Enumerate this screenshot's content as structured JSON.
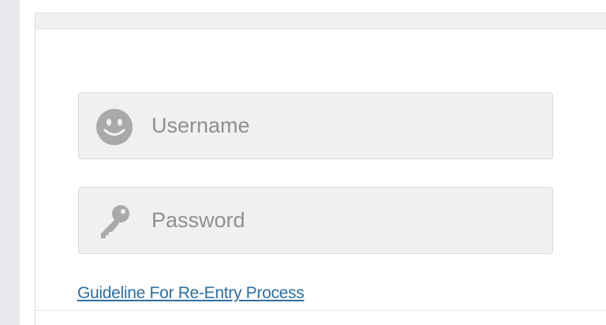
{
  "login_form": {
    "username": {
      "placeholder": "Username",
      "value": "",
      "icon": "smiley-user-icon"
    },
    "password": {
      "placeholder": "Password",
      "value": "",
      "icon": "key-icon"
    },
    "guideline_link": "Guideline For Re-Entry Process"
  },
  "colors": {
    "field_background": "#f0f0f0",
    "placeholder_text": "#8f8f8f",
    "icon_gray": "#a9a9a9",
    "link": "#2d6fa3",
    "left_strip": "#e7e8ec"
  }
}
